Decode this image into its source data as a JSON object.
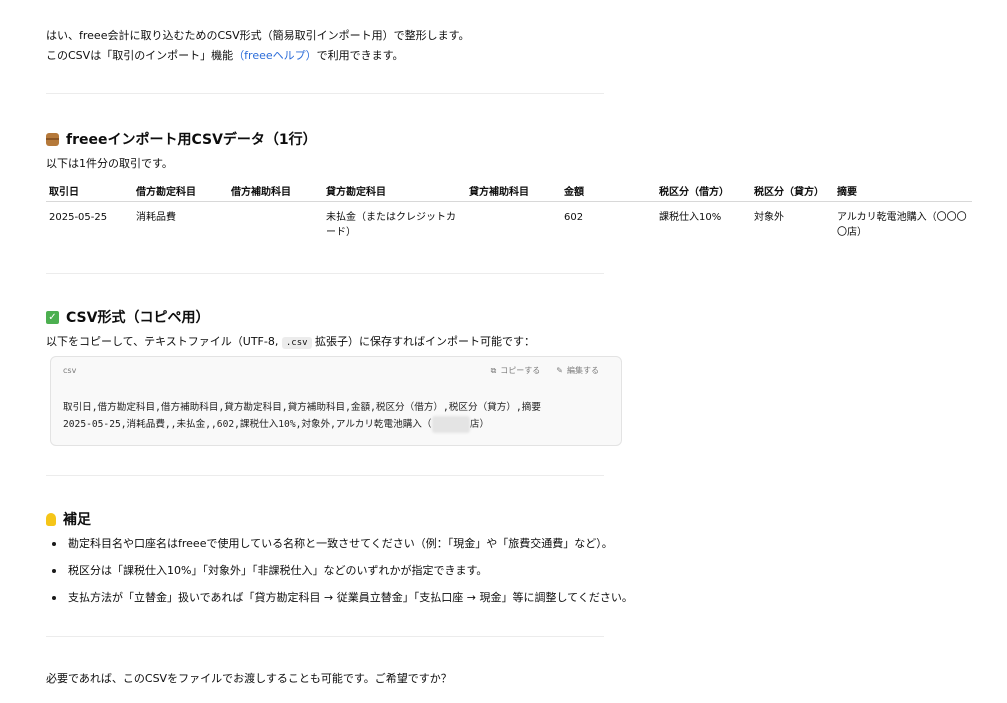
{
  "intro": {
    "line1": "はい、freee会計に取り込むためのCSV形式（簡易取引インポート用）で整形します。",
    "line2_pre": "このCSVは「取引のインポート」機能",
    "line2_link": "（freeeヘルプ）",
    "line2_post": "で利用できます。"
  },
  "section1": {
    "icon": "package-icon",
    "title": "freeeインポート用CSVデータ（1行）",
    "subtitle": "以下は1件分の取引です。",
    "table": {
      "headers": [
        "取引日",
        "借方勘定科目",
        "借方補助科目",
        "貸方勘定科目",
        "貸方補助科目",
        "金額",
        "税区分（借方）",
        "税区分（貸方）",
        "摘要"
      ],
      "rows": [
        [
          "2025-05-25",
          "消耗品費",
          "",
          "未払金（またはクレジットカード）",
          "",
          "602",
          "課税仕入10%",
          "対象外",
          "アルカリ乾電池購入（〇〇〇〇店）"
        ]
      ]
    }
  },
  "section2": {
    "icon": "check-mark-icon",
    "title": "CSV形式（コピペ用）",
    "desc_pre": "以下をコピーして、テキストファイル（UTF-8,",
    "desc_code": ".csv",
    "desc_post": "拡張子）に保存すればインポート可能です：",
    "code": {
      "lang": "csv",
      "copy_label": "コピーする",
      "edit_label": "編集する",
      "line1": "取引日,借方勘定科目,借方補助科目,貸方勘定科目,貸方補助科目,金額,税区分（借方）,税区分（貸方）,摘要",
      "line2_pre": "2025-05-25,消耗品費,,未払金,,602,課税仕入10%,対象外,アルカリ乾電池購入（",
      "line2_post": "店）"
    }
  },
  "section3": {
    "icon": "light-bulb-icon",
    "title": "補足",
    "notes": [
      "勘定科目名や口座名はfreeeで使用している名称と一致させてください（例：「現金」や「旅費交通費」など）。",
      "税区分は「課税仕入10%」「対象外」「非課税仕入」などのいずれかが指定できます。",
      "支払方法が「立替金」扱いであれば「貸方勘定科目 → 従業員立替金」「支払口座 → 現金」等に調整してください。"
    ]
  },
  "closing": "必要であれば、このCSVをファイルでお渡しすることも可能です。ご希望ですか？"
}
